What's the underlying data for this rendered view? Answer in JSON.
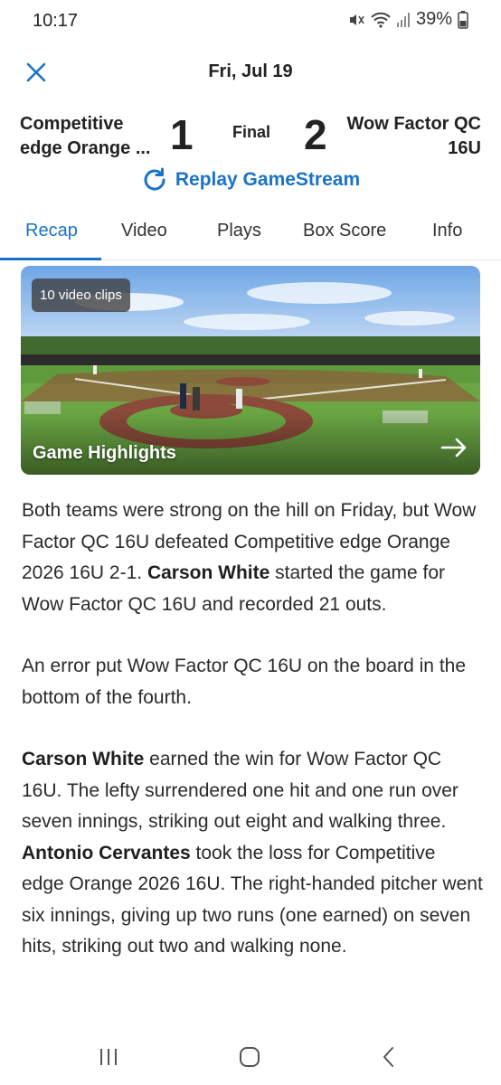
{
  "status_bar": {
    "time": "10:17",
    "battery": "39%"
  },
  "header": {
    "date": "Fri, Jul 19"
  },
  "game": {
    "home_team": "Competitive edge Orange ...",
    "home_score": "1",
    "status": "Final",
    "away_score": "2",
    "away_team": "Wow Factor QC 16U"
  },
  "replay_label": "Replay GameStream",
  "tabs": [
    {
      "label": "Recap"
    },
    {
      "label": "Video"
    },
    {
      "label": "Plays"
    },
    {
      "label": "Box Score"
    },
    {
      "label": "Info"
    }
  ],
  "video": {
    "clips": "10 video clips",
    "title": "Game Highlights"
  },
  "article": {
    "p1": {
      "a": "Both teams were strong on the hill on Friday, but Wow Factor QC 16U defeated Competitive edge Orange 2026 16U 2-1. ",
      "b": "Carson White",
      "c": " started the game for Wow Factor QC 16U and recorded 21 outs."
    },
    "p2": "An error put Wow Factor QC 16U on the board in the bottom of the fourth.",
    "p3": {
      "a": "Carson White",
      "b": " earned the win for Wow Factor QC 16U. The lefty surrendered one hit and one run over seven innings, striking out eight and walking three. ",
      "c": "Antonio Cervantes",
      "d": " took the loss for Competitive edge Orange 2026 16U. The right-handed pitcher went six innings, giving up two runs (one earned) on seven hits, striking out two and walking none."
    }
  },
  "icons": {
    "close": "close-icon",
    "replay": "refresh-icon",
    "video_arrow": "arrow-right-icon",
    "nav_recent": "recent-apps-icon",
    "nav_home": "home-icon",
    "nav_back": "back-icon"
  },
  "colors": {
    "accent": "#1a73c8"
  }
}
